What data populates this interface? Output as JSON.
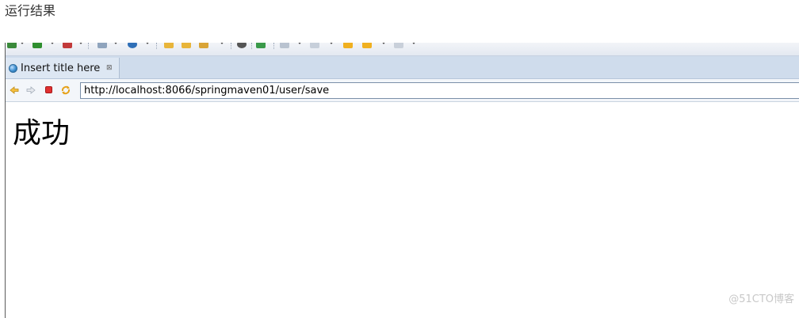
{
  "caption": "运行结果",
  "browser": {
    "tab": {
      "title": "Insert title here",
      "close_glyph": "⊠",
      "icon": "globe-icon"
    },
    "nav": {
      "back_icon": "back-arrow-icon",
      "forward_icon": "forward-arrow-icon",
      "stop_icon": "stop-icon",
      "refresh_icon": "refresh-icon",
      "url": "http://localhost:8066/springmaven01/user/save"
    }
  },
  "page": {
    "heading": "成功"
  },
  "watermark": "@51CTO博客",
  "colors": {
    "tabbar": "#cfdcec",
    "tab_active": "#dde7f3",
    "stop": "#e03030",
    "arrow": "#f0b020"
  }
}
